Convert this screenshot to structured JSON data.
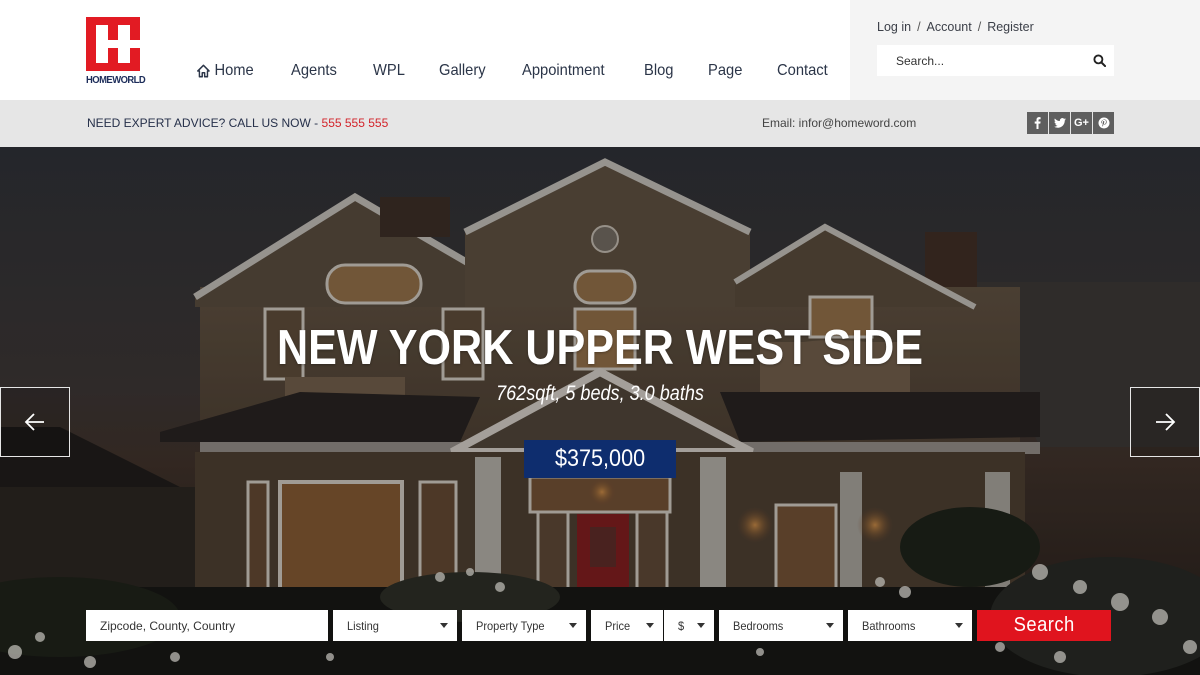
{
  "brand": {
    "name": "HOMEWORLD",
    "logo_color": "#e21b23",
    "logo_text_color": "#1d2d5a"
  },
  "nav": {
    "items": [
      {
        "label": "Home",
        "icon": "home-icon"
      },
      {
        "label": "Agents"
      },
      {
        "label": "WPL"
      },
      {
        "label": "Gallery"
      },
      {
        "label": "Appointment"
      },
      {
        "label": "Blog"
      },
      {
        "label": "Page"
      },
      {
        "label": "Contact"
      }
    ]
  },
  "account": {
    "login": "Log in",
    "account": "Account",
    "register": "Register",
    "separator": "/"
  },
  "header_search": {
    "placeholder": "Search...",
    "icon": "search-icon"
  },
  "infobar": {
    "call_text": "NEED EXPERT ADVICE? CALL US NOW - ",
    "phone": "555 555 555",
    "phone_color": "#d3242b",
    "email": "Email: infor@homeword.com",
    "social": [
      {
        "name": "facebook",
        "glyph": "f"
      },
      {
        "name": "twitter",
        "glyph": "t"
      },
      {
        "name": "google-plus",
        "glyph": "G+"
      },
      {
        "name": "pinterest",
        "glyph": "p"
      }
    ]
  },
  "hero": {
    "title": "NEW YORK UPPER WEST SIDE",
    "subtitle": "762sqft, 5 beds, 3.0 baths",
    "price": "$375,000",
    "price_bg": "#0e2d6e",
    "prev_icon": "arrow-left-icon",
    "next_icon": "arrow-right-icon"
  },
  "search_form": {
    "location_placeholder": "Zipcode, County, Country",
    "listing": "Listing",
    "property_type": "Property Type",
    "price": "Price",
    "currency": "$",
    "bedrooms": "Bedrooms",
    "bathrooms": "Bathrooms",
    "submit": "Search",
    "submit_color": "#e0141e"
  }
}
